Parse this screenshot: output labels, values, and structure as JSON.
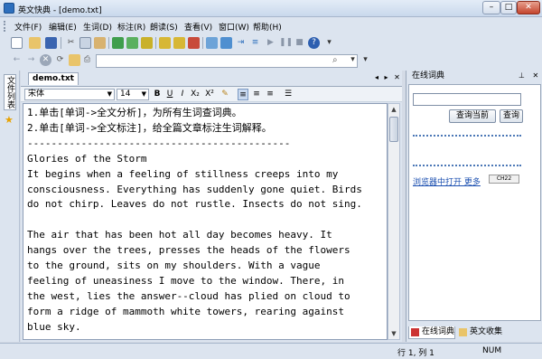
{
  "window": {
    "title": "英文快典 - [demo.txt]",
    "min": "–",
    "max": "□",
    "close": "✕"
  },
  "menu": [
    "文件(F)",
    "编辑(E)",
    "生词(D)",
    "标注(R)",
    "朗读(S)",
    "查看(V)",
    "窗口(W)",
    "帮助(H)"
  ],
  "sidebar": {
    "tab_label": "文件列表"
  },
  "document": {
    "tab_label": "demo.txt",
    "font": "宋体",
    "size": "14",
    "format_buttons": [
      "B",
      "U",
      "I",
      "X₂",
      "X²"
    ],
    "lines": [
      "1.单击[单词->全文分析]，为所有生词查词典。",
      "2.单击[单词->全文标注]，给全篇文章标注生词解释。",
      "--------------------------------------------",
      "Glories of the Storm",
      "It begins when a feeling of stillness creeps into my",
      "consciousness. Everything has suddenly gone quiet. Birds",
      "do not chirp. Leaves do not rustle. Insects do not sing.",
      "",
      "The air that has been hot all day becomes heavy. It",
      "hangs over the trees, presses the heads of the flowers",
      "to the ground, sits on my shoulders. With a vague",
      "feeling of uneasiness I move to the window. There, in",
      "the west, lies the answer--cloud has plied on cloud to",
      "form a ridge of mammoth white towers, rearing against",
      "blue sky."
    ]
  },
  "online_dict": {
    "title": "在线词典",
    "btn_lookup_current": "查询当前",
    "btn_lookup": "查询",
    "link_text": "浏览器中打开 更多",
    "logo_text": "CH22",
    "tabs": [
      "在线词典",
      "英文收集"
    ]
  },
  "status": {
    "position": "行 1, 列 1",
    "num": "NUM"
  }
}
